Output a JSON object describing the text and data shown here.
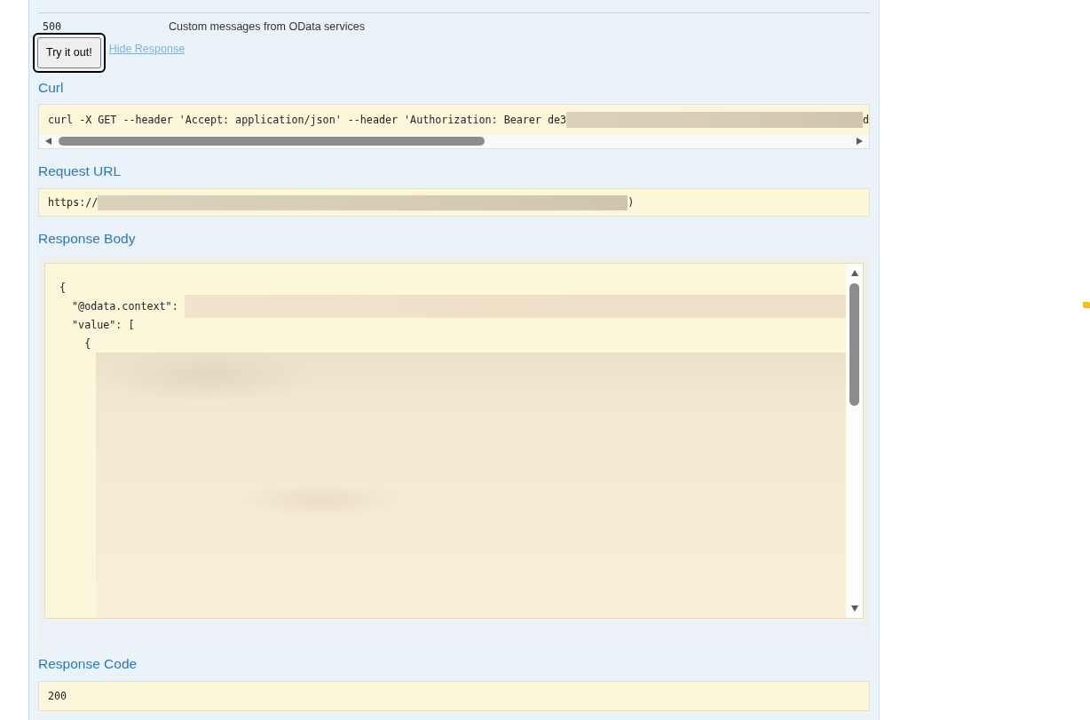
{
  "responses_table": {
    "rows": [
      {
        "code": "500",
        "message": "Custom messages from OData services"
      }
    ]
  },
  "actions": {
    "try_button": {
      "label": "Try it out!",
      "focused": true
    },
    "hide_link": {
      "label": "Hide Response"
    }
  },
  "curl": {
    "heading": "Curl",
    "command_start": "curl -X GET --header 'Accept: application/json' --header 'Authorization: Bearer de3",
    "command_end": "d"
  },
  "request_url": {
    "heading": "Request URL",
    "start": "https://",
    "end": ")"
  },
  "response_body": {
    "heading": "Response Body",
    "lines": [
      {
        "text": "{",
        "redacted": false
      },
      {
        "text": "  \"@odata.context\": ",
        "redacted": true
      },
      {
        "text": "  \"value\": [",
        "redacted": false
      },
      {
        "text": "    {",
        "redacted": false
      }
    ]
  },
  "response_code": {
    "heading": "Response Code",
    "value": "200"
  }
}
